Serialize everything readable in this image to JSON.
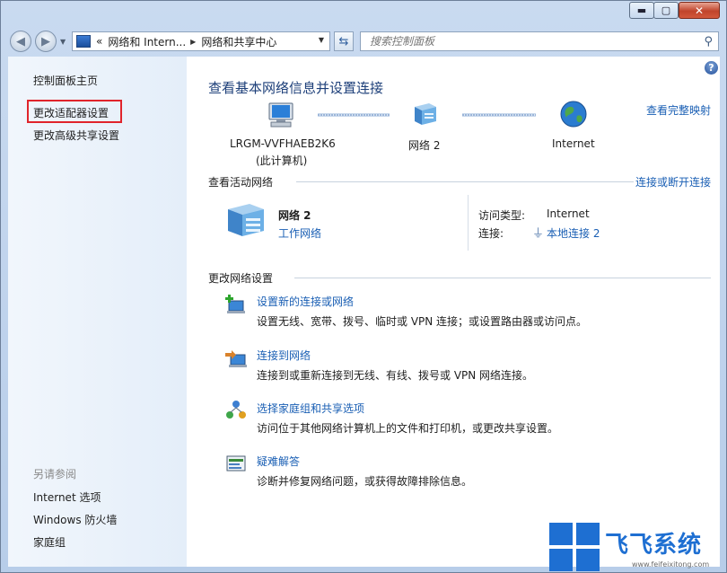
{
  "window": {
    "buttons": {
      "minimize": "▬",
      "maximize": "▢",
      "close": "✕"
    }
  },
  "address_bar": {
    "prefix": "«",
    "crumbs": [
      "网络和 Intern...",
      "网络和共享中心"
    ],
    "search_placeholder": "搜索控制面板"
  },
  "sidebar": {
    "home": "控制面板主页",
    "items": [
      "更改适配器设置",
      "更改高级共享设置"
    ],
    "see_also_title": "另请参阅",
    "see_also": [
      "Internet 选项",
      "Windows 防火墙",
      "家庭组"
    ]
  },
  "main": {
    "help": "?",
    "title": "查看基本网络信息并设置连接",
    "full_map_link": "查看完整映射",
    "map": {
      "computer_name": "LRGM-VVFHAEB2K6",
      "computer_sub": "(此计算机)",
      "network": "网络  2",
      "internet": "Internet"
    },
    "active": {
      "section_title": "查看活动网络",
      "connect_link": "连接或断开连接",
      "network_name": "网络  2",
      "network_type": "工作网络",
      "access_label": "访问类型:",
      "access_value": "Internet",
      "conn_label": "连接:",
      "conn_value": "本地连接 2"
    },
    "change": {
      "section_title": "更改网络设置",
      "tasks": [
        {
          "title": "设置新的连接或网络",
          "desc": "设置无线、宽带、拨号、临时或 VPN 连接；或设置路由器或访问点。"
        },
        {
          "title": "连接到网络",
          "desc": "连接到或重新连接到无线、有线、拨号或 VPN 网络连接。"
        },
        {
          "title": "选择家庭组和共享选项",
          "desc": "访问位于其他网络计算机上的文件和打印机，或更改共享设置。"
        },
        {
          "title": "疑难解答",
          "desc": "诊断并修复网络问题，或获得故障排除信息。"
        }
      ]
    }
  },
  "watermark": {
    "text": "飞飞系统",
    "url": "www.feifeixitong.com"
  },
  "colors": {
    "link": "#1a5fb4",
    "title": "#1d3f79",
    "highlight": "#e0242b",
    "watermark": "#1e6fd2"
  }
}
